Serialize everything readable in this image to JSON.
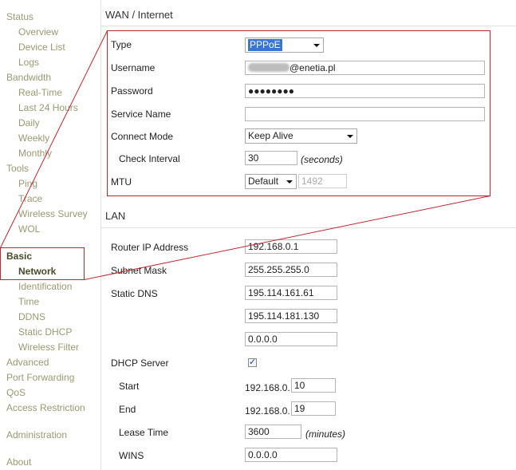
{
  "sidebar": {
    "items": [
      {
        "label": "Status",
        "level": 0
      },
      {
        "label": "Overview",
        "level": 1
      },
      {
        "label": "Device List",
        "level": 1
      },
      {
        "label": "Logs",
        "level": 1
      },
      {
        "label": "Bandwidth",
        "level": 0
      },
      {
        "label": "Real-Time",
        "level": 1
      },
      {
        "label": "Last 24 Hours",
        "level": 1
      },
      {
        "label": "Daily",
        "level": 1
      },
      {
        "label": "Weekly",
        "level": 1
      },
      {
        "label": "Monthly",
        "level": 1
      },
      {
        "label": "Tools",
        "level": 0
      },
      {
        "label": "Ping",
        "level": 1
      },
      {
        "label": "Trace",
        "level": 1
      },
      {
        "label": "Wireless Survey",
        "level": 1
      },
      {
        "label": "WOL",
        "level": 1
      },
      {
        "label": "Basic",
        "level": 0,
        "active": true
      },
      {
        "label": "Network",
        "level": 1,
        "active": true
      },
      {
        "label": "Identification",
        "level": 1
      },
      {
        "label": "Time",
        "level": 1
      },
      {
        "label": "DDNS",
        "level": 1
      },
      {
        "label": "Static DHCP",
        "level": 1
      },
      {
        "label": "Wireless Filter",
        "level": 1
      },
      {
        "label": "Advanced",
        "level": 0
      },
      {
        "label": "Port Forwarding",
        "level": 0
      },
      {
        "label": "QoS",
        "level": 0
      },
      {
        "label": "Access Restriction",
        "level": 0
      },
      {
        "label": "Administration",
        "level": 0
      },
      {
        "label": "About",
        "level": 0
      }
    ]
  },
  "wan": {
    "title": "WAN / Internet",
    "type_label": "Type",
    "type_value": "PPPoE",
    "username_label": "Username",
    "username_value": "@enetia.pl",
    "password_label": "Password",
    "password_value": "●●●●●●●●",
    "service_name_label": "Service Name",
    "service_name_value": "",
    "connect_mode_label": "Connect Mode",
    "connect_mode_value": "Keep Alive",
    "check_interval_label": "Check Interval",
    "check_interval_value": "30",
    "check_interval_unit": "(seconds)",
    "mtu_label": "MTU",
    "mtu_mode_value": "Default",
    "mtu_value": "1492"
  },
  "lan": {
    "title": "LAN",
    "router_ip_label": "Router IP Address",
    "router_ip_value": "192.168.0.1",
    "subnet_mask_label": "Subnet Mask",
    "subnet_mask_value": "255.255.255.0",
    "static_dns_label": "Static DNS",
    "static_dns_values": [
      "195.114.161.61",
      "195.114.181.130",
      "0.0.0.0"
    ],
    "dhcp_server_label": "DHCP Server",
    "dhcp_server_checked": true,
    "start_label": "Start",
    "start_prefix": "192.168.0.",
    "start_value": "10",
    "end_label": "End",
    "end_prefix": "192.168.0.",
    "end_value": "19",
    "lease_time_label": "Lease Time",
    "lease_time_value": "3600",
    "lease_time_unit": "(minutes)",
    "wins_label": "WINS",
    "wins_value": "0.0.0.0"
  },
  "colors": {
    "annotation_red": "#c0272d",
    "selection_blue": "#3875d7",
    "nav_text": "#9a9a73"
  }
}
